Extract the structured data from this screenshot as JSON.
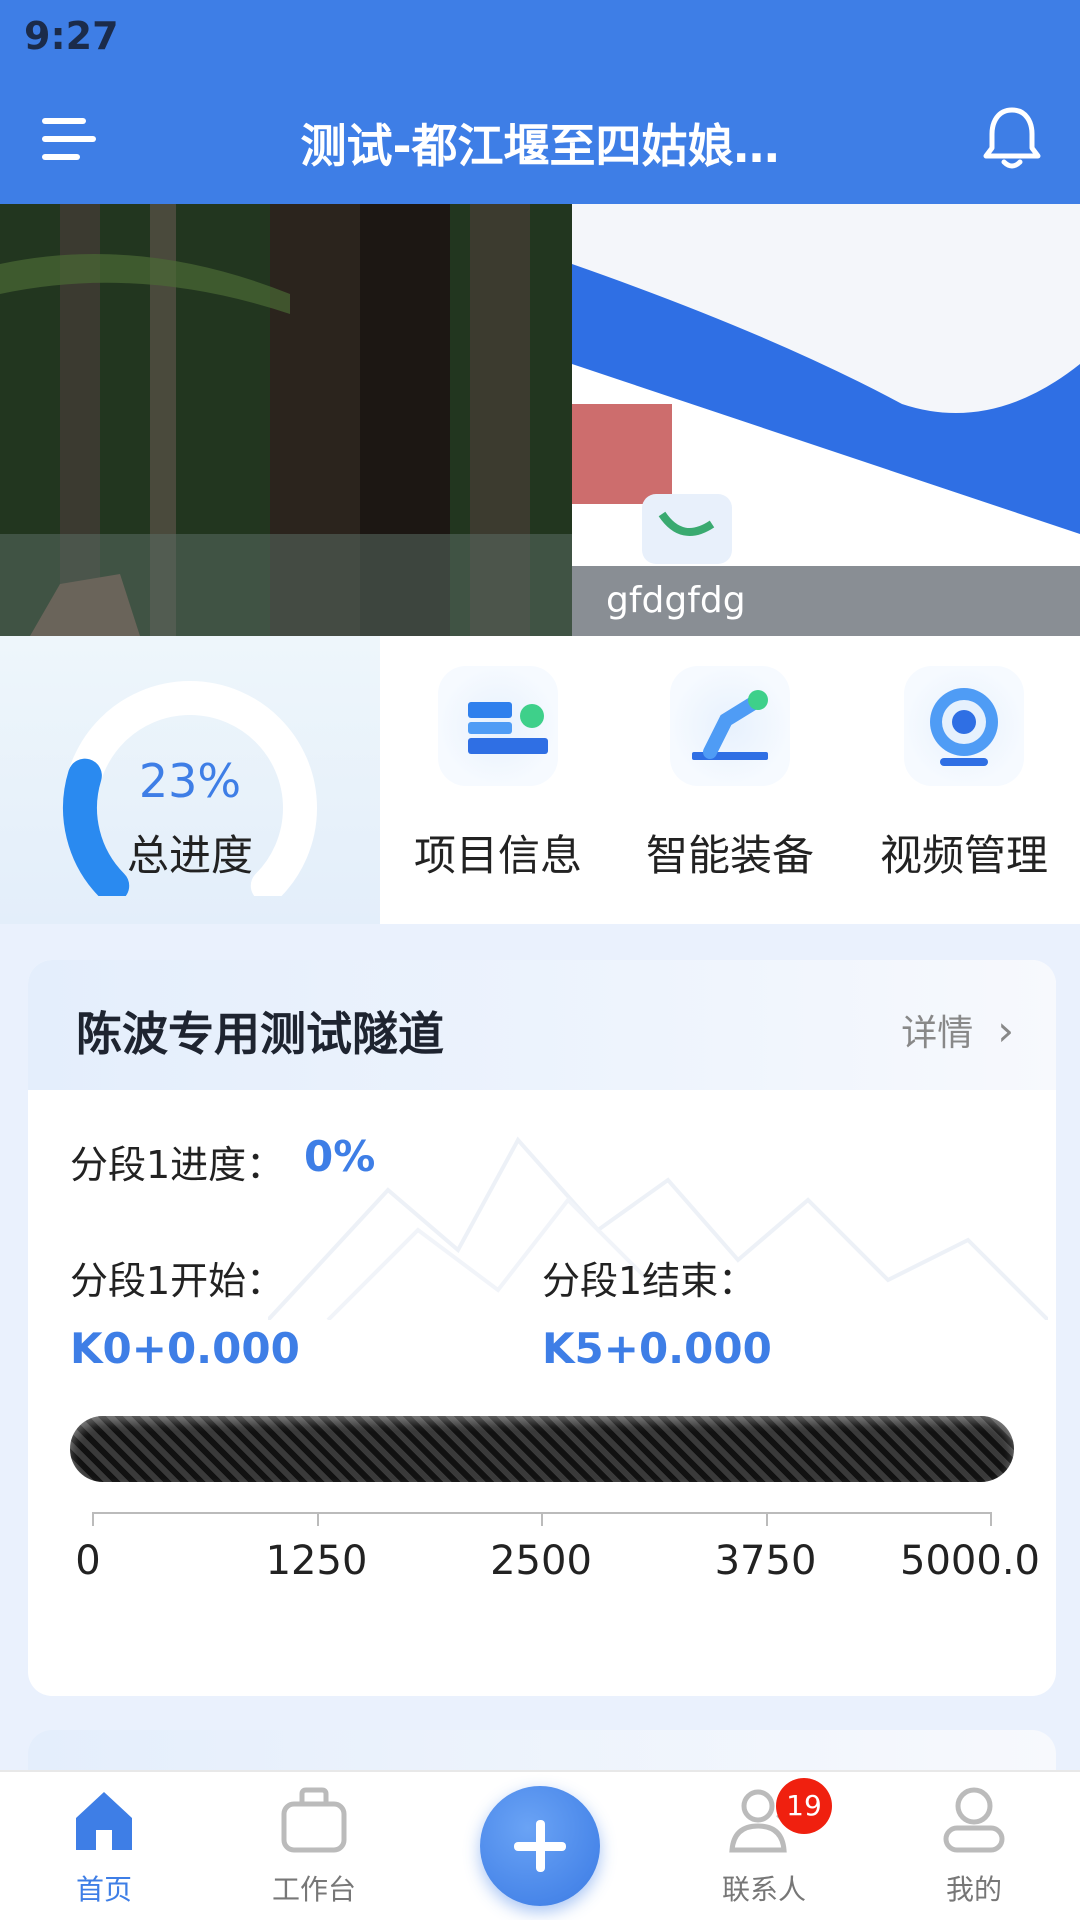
{
  "status_bar": {
    "time": "9:27"
  },
  "header": {
    "title": "测试-都江堰至四姑娘…"
  },
  "banners": [
    {
      "caption": ""
    },
    {
      "caption": "gfdgfdg"
    }
  ],
  "overall_progress": {
    "percent_text": "23%",
    "label": "总进度",
    "fraction": 0.23
  },
  "quick_actions": [
    {
      "label": "项目信息",
      "icon": "project-info-icon"
    },
    {
      "label": "智能装备",
      "icon": "smart-equipment-icon"
    },
    {
      "label": "视频管理",
      "icon": "video-camera-icon"
    }
  ],
  "tunnel_card": {
    "title": "陈波专用测试隧道",
    "detail_label": "详情",
    "segment_progress_label": "分段1进度：",
    "segment_progress_value": "0%",
    "segment_progress_fraction": 0,
    "start_label": "分段1开始：",
    "start_value": "K0+0.000",
    "end_label": "分段1结束：",
    "end_value": "K5+0.000",
    "scale_ticks": [
      "0",
      "1250",
      "2500",
      "3750",
      "5000.0"
    ]
  },
  "bottom_nav": {
    "items": [
      {
        "label": "首页",
        "icon": "home-icon",
        "active": true
      },
      {
        "label": "工作台",
        "icon": "briefcase-icon",
        "active": false
      },
      {
        "label": "联系人",
        "icon": "contacts-icon",
        "active": false,
        "badge": "19"
      },
      {
        "label": "我的",
        "icon": "user-icon",
        "active": false
      }
    ]
  },
  "colors": {
    "primary": "#3e7ee6",
    "badge": "#f0200f"
  }
}
